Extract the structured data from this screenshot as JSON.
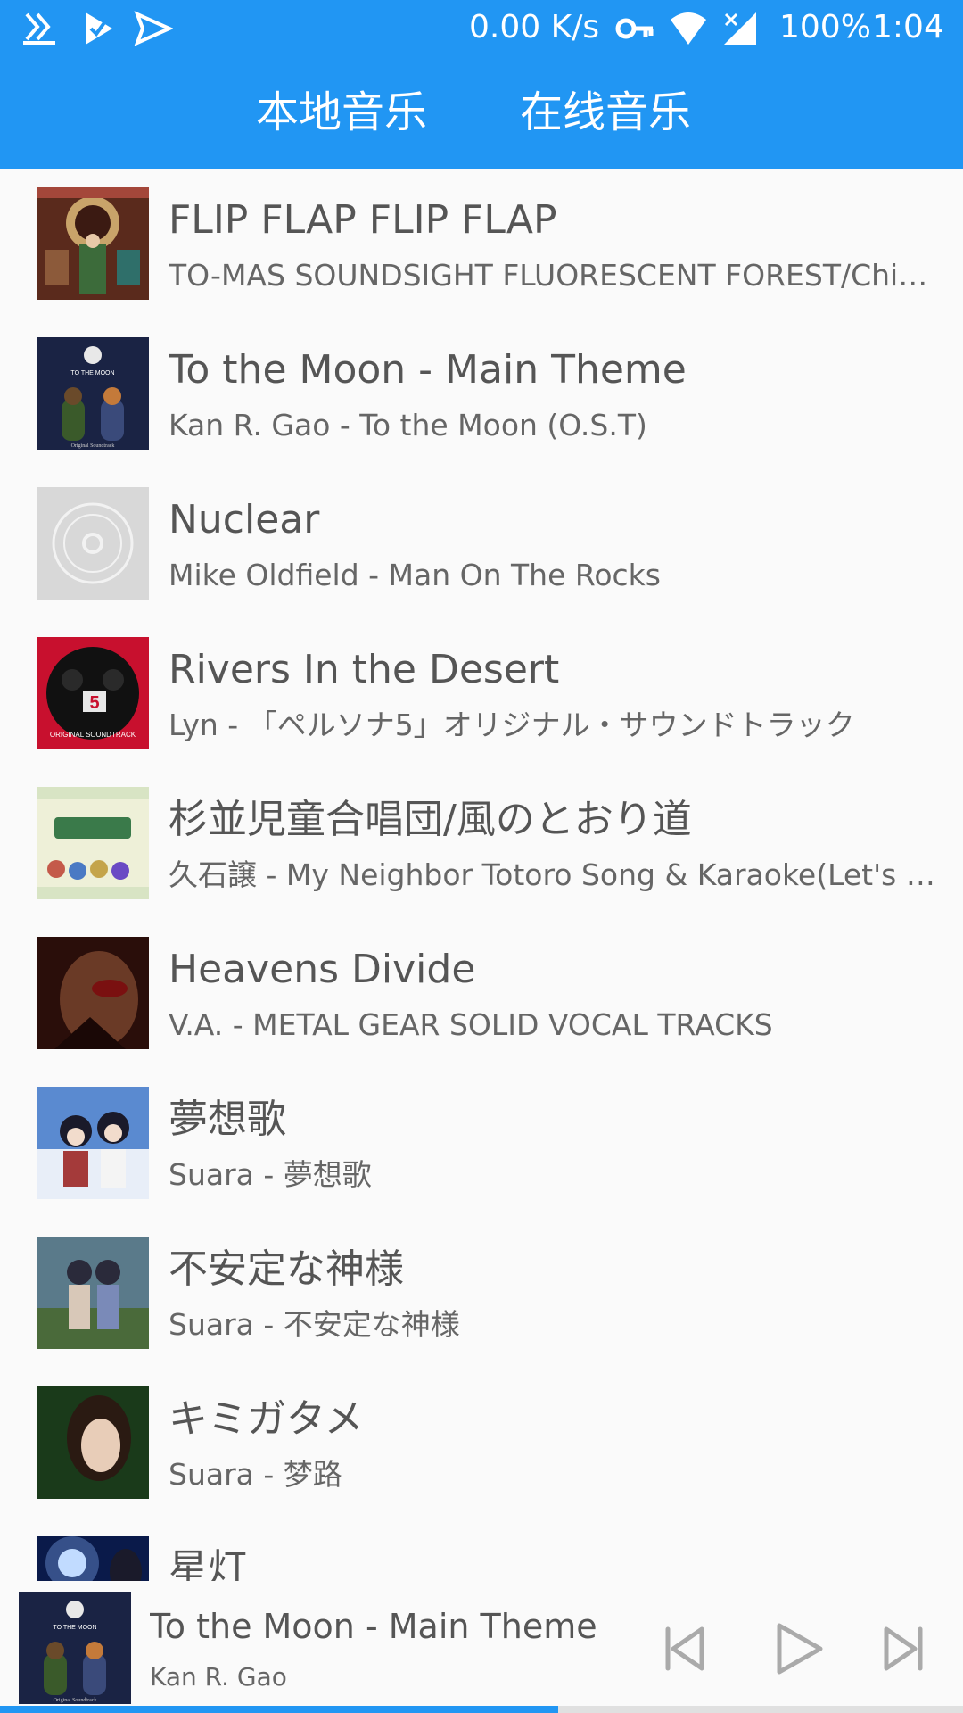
{
  "status_bar": {
    "icons_left": [
      "download-icon",
      "check-flag-icon",
      "send-icon"
    ],
    "net_speed": "0.00 K/s",
    "icons_right": [
      "vpn-key-icon",
      "wifi-icon",
      "cell-signal-icon"
    ],
    "battery": "100%",
    "time": "1:04"
  },
  "tabs": [
    {
      "label": "本地音乐",
      "active": true
    },
    {
      "label": "在线音乐",
      "active": false
    }
  ],
  "songs": [
    {
      "title": "FLIP FLAP FLIP FLAP",
      "subtitle": "TO-MAS SOUNDSIGHT FLUORESCENT FOREST/Chi…",
      "cover": "tomas-soundsight-cover"
    },
    {
      "title": "To the Moon - Main Theme",
      "subtitle": "Kan R. Gao - To the Moon (O.S.T)",
      "cover": "to-the-moon-cover",
      "cover_text": "TO THE MOON",
      "cover_caption": "Original Soundtrack"
    },
    {
      "title": "Nuclear",
      "subtitle": "Mike Oldfield - Man On The Rocks",
      "cover": "default-disc-cover"
    },
    {
      "title": "Rivers In the Desert",
      "subtitle": "Lyn - 「ペルソナ5」オリジナル・サウンドトラック",
      "cover": "persona5-cover",
      "cover_caption": "ORIGINAL SOUNDTRACK"
    },
    {
      "title": "杉並児童合唱団/風のとおり道",
      "subtitle": "久石譲 - My Neighbor Totoro Song & Karaoke(Let's S…",
      "cover": "totoro-cover"
    },
    {
      "title": "Heavens Divide",
      "subtitle": "V.A. - METAL GEAR SOLID VOCAL TRACKS",
      "cover": "mgs-cover"
    },
    {
      "title": "夢想歌",
      "subtitle": "Suara - 夢想歌",
      "cover": "suara-musouka-cover"
    },
    {
      "title": "不安定な神様",
      "subtitle": "Suara - 不安定な神様",
      "cover": "suara-fuantei-cover"
    },
    {
      "title": "キミガタメ",
      "subtitle": "Suara - 梦路",
      "cover": "suara-yumeji-cover"
    },
    {
      "title": "星灯",
      "subtitle": "",
      "cover": "hoshiakari-cover"
    }
  ],
  "player": {
    "title": "To the Moon - Main Theme",
    "artist": "Kan R. Gao",
    "cover": "to-the-moon-cover",
    "controls": [
      "previous-icon",
      "play-icon",
      "next-icon"
    ],
    "progress": 0.58
  },
  "colors": {
    "accent": "#2196f3",
    "background": "#fafafa",
    "text": "#555555"
  }
}
